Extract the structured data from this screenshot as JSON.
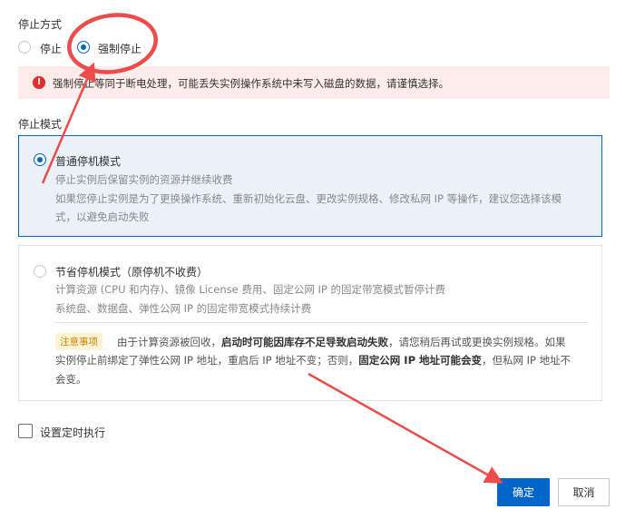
{
  "stop_method": {
    "label": "停止方式",
    "options": [
      "停止",
      "强制停止"
    ],
    "selected": "强制停止"
  },
  "warning": {
    "icon": "error-icon",
    "text": "强制停止等同于断电处理，可能丢失实例操作系统中未写入磁盘的数据，请谨慎选择。"
  },
  "stop_mode": {
    "label": "停止模式",
    "normal": {
      "title": "普通停机模式",
      "desc1": "停止实例后保留实例的资源并继续收费",
      "desc2": "如果您停止实例是为了更换操作系统、重新初始化云盘、更改实例规格、修改私网 IP 等操作，建议您选择该模",
      "desc3": "式，以避免启动失败"
    },
    "economy": {
      "title": "节省停机模式（原停机不收费）",
      "desc1": "计算资源 (CPU 和内存)、镜像 License 费用、固定公网 IP 的固定带宽模式暂停计费",
      "desc2": "系统盘、数据盘、弹性公网 IP 的固定带宽模式持续计费",
      "notice_badge": "注意事项",
      "notice1_a": "由于计算资源被回收，",
      "notice1_b": "启动时可能因库存不足导致启动失败",
      "notice1_c": "，请您稍后再试或更换实例规格。如果",
      "notice2_a": "实例停止前绑定了弹性公网 IP 地址，重启后 IP 地址不变；否则，",
      "notice2_b": "固定公网 IP 地址可能会变",
      "notice2_c": "，但私网 IP 地址不",
      "notice3": "会变。"
    }
  },
  "schedule": {
    "label": "设置定时执行",
    "checked": false
  },
  "buttons": {
    "confirm": "确定",
    "cancel": "取消"
  },
  "colors": {
    "primary": "#0064c8",
    "warning_bg": "#fdecea",
    "annotation": "#ee4b4b"
  }
}
